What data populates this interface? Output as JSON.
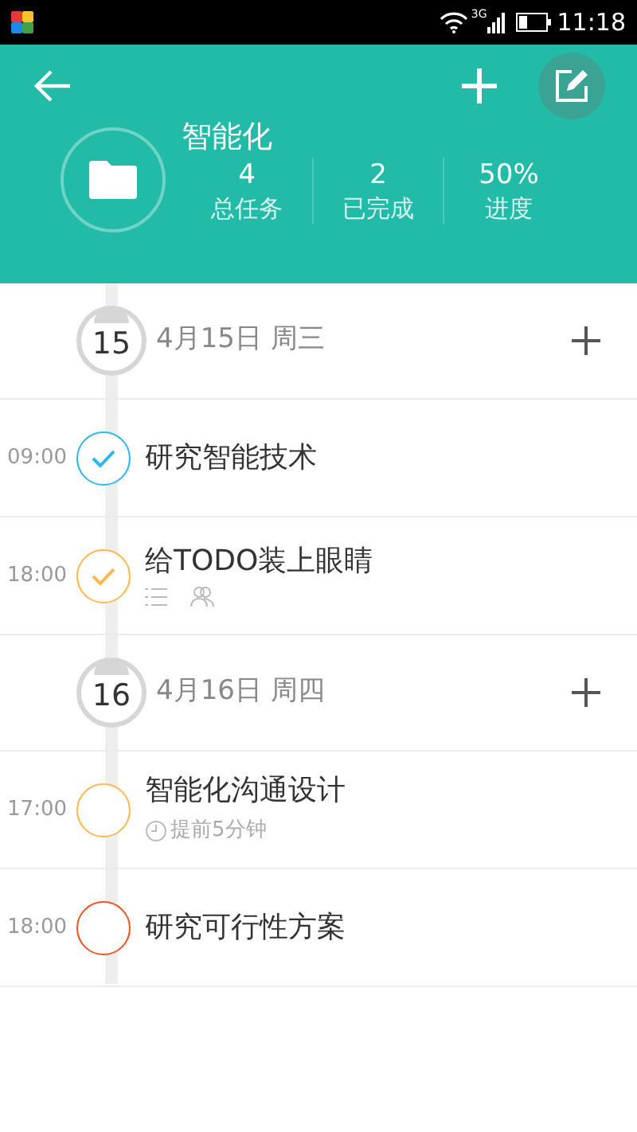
{
  "status_bar": {
    "network": "3G",
    "time": "11:18"
  },
  "project": {
    "name": "智能化",
    "stats": [
      {
        "value": "4",
        "label": "总任务"
      },
      {
        "value": "2",
        "label": "已完成"
      },
      {
        "value": "50%",
        "label": "进度"
      }
    ]
  },
  "days": [
    {
      "day": "15",
      "date": "4月15日 周三",
      "tasks": [
        {
          "time": "09:00",
          "title": "研究智能技术",
          "checked": true,
          "color": "#29b6f6",
          "kind": "plain"
        },
        {
          "time": "18:00",
          "title": "给TODO装上眼睛",
          "checked": true,
          "color": "#ffb74d",
          "kind": "attachments"
        }
      ]
    },
    {
      "day": "16",
      "date": "4月16日 周四",
      "tasks": [
        {
          "time": "17:00",
          "title": "智能化沟通设计",
          "checked": false,
          "color": "#ffb74d",
          "kind": "reminder",
          "reminder": "提前5分钟"
        },
        {
          "time": "18:00",
          "title": "研究可行性方案",
          "checked": false,
          "color": "#f4511e",
          "kind": "plain"
        }
      ]
    }
  ]
}
